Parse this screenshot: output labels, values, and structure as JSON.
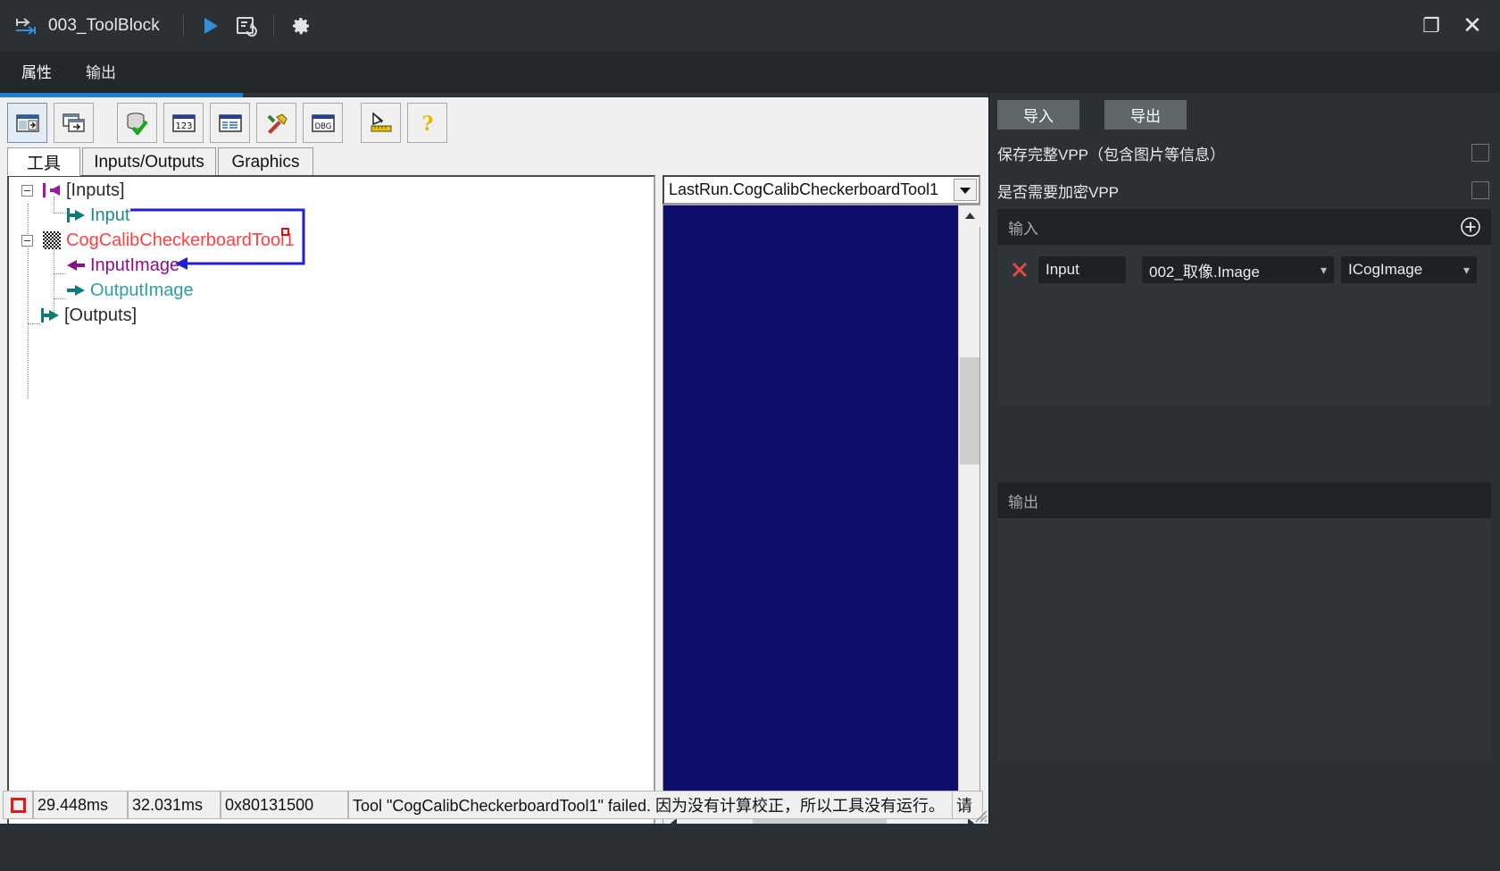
{
  "window": {
    "title": "003_ToolBlock",
    "app_icon": "toolblock-icon",
    "run_icon": "run-play-icon",
    "runonce_icon": "run-once-icon",
    "settings_icon": "gear-icon",
    "restore_label": "❐",
    "close_label": "✕"
  },
  "vtabs": [
    {
      "label": "属性",
      "active": true
    },
    {
      "label": "输出",
      "active": false
    }
  ],
  "toolbar": {
    "buttons": [
      {
        "name": "show-inputs-outputs-icon",
        "glyph": "panel-split-icon",
        "pressed": true
      },
      {
        "name": "show-tool-copy-icon",
        "glyph": "panel-copy-icon",
        "pressed": false
      },
      {
        "name": "database-check-icon",
        "glyph": "db-check-icon",
        "pressed": false
      },
      {
        "name": "numbers-123-icon",
        "glyph": "123-icon",
        "pressed": false
      },
      {
        "name": "properties-list-icon",
        "glyph": "list-icon",
        "pressed": false
      },
      {
        "name": "tools-hammer-icon",
        "glyph": "hammer-wrench-icon",
        "pressed": false
      },
      {
        "name": "debug-icon",
        "glyph": "dbg-icon",
        "pressed": false
      },
      {
        "name": "measure-ruler-icon",
        "glyph": "ruler-icon",
        "pressed": false
      },
      {
        "name": "help-icon",
        "glyph": "question-icon",
        "pressed": false
      }
    ]
  },
  "classic_tabs": [
    {
      "label": "工具",
      "active": true
    },
    {
      "label": "Inputs/Outputs",
      "active": false
    },
    {
      "label": "Graphics",
      "active": false
    }
  ],
  "tree": {
    "nodes": [
      {
        "label": "[Inputs]",
        "color": "#2b2b2b",
        "icon": "arrow-left-magenta-icon",
        "depth": 0,
        "expander": true
      },
      {
        "label": "Input",
        "color": "#1f8a8a",
        "icon": "arrow-right-teal-icon",
        "depth": 1,
        "expander": false
      },
      {
        "label": "CogCalibCheckerboardTool1",
        "color": "#ff4040",
        "icon": "checkerboard-icon",
        "depth": 0,
        "expander": true,
        "error_marker": true
      },
      {
        "label": "InputImage",
        "color": "#8a0f8a",
        "icon": "arrow-left-purple-icon",
        "depth": 1,
        "expander": false
      },
      {
        "label": "OutputImage",
        "color": "#1f8a8a",
        "icon": "arrow-right-teal-icon",
        "depth": 1,
        "expander": false
      },
      {
        "label": "[Outputs]",
        "color": "#2b2b2b",
        "icon": "arrow-right-teal-icon",
        "depth": 0,
        "expander": false
      }
    ],
    "link_color": "#1f1fd6"
  },
  "image_view": {
    "combo_value": "LastRun.CogCalibCheckerboardTool1",
    "combo_arrow": "▼",
    "canvas_color": "#0e0e6b",
    "scroll_up": "ⱏ",
    "scroll_down": "ⱟ",
    "scroll_left": "‹",
    "scroll_right": "›"
  },
  "status_bar": {
    "result_icon": "red-square-stop-icon",
    "time_1": "29.448ms",
    "time_2": "32.031ms",
    "code": "0x80131500",
    "message": "Tool \"CogCalibCheckerboardTool1\" failed. 因为没有计算校正，所以工具没有运行。",
    "message_tail": "请"
  },
  "right_panel": {
    "import_button": "导入",
    "export_button": "导出",
    "options": [
      {
        "label": "保存完整VPP（包含图片等信息）",
        "checked": false
      },
      {
        "label": "是否需要加密VPP",
        "checked": false
      }
    ],
    "input_section": {
      "title": "输入",
      "add_icon": "plus-circle-icon",
      "rows": [
        {
          "remove_icon": "x-remove-icon",
          "name": "Input",
          "source": "002_取像.Image",
          "type": "ICogImage",
          "caret": "∨"
        }
      ]
    },
    "output_section": {
      "title": "输出",
      "rows": []
    }
  }
}
